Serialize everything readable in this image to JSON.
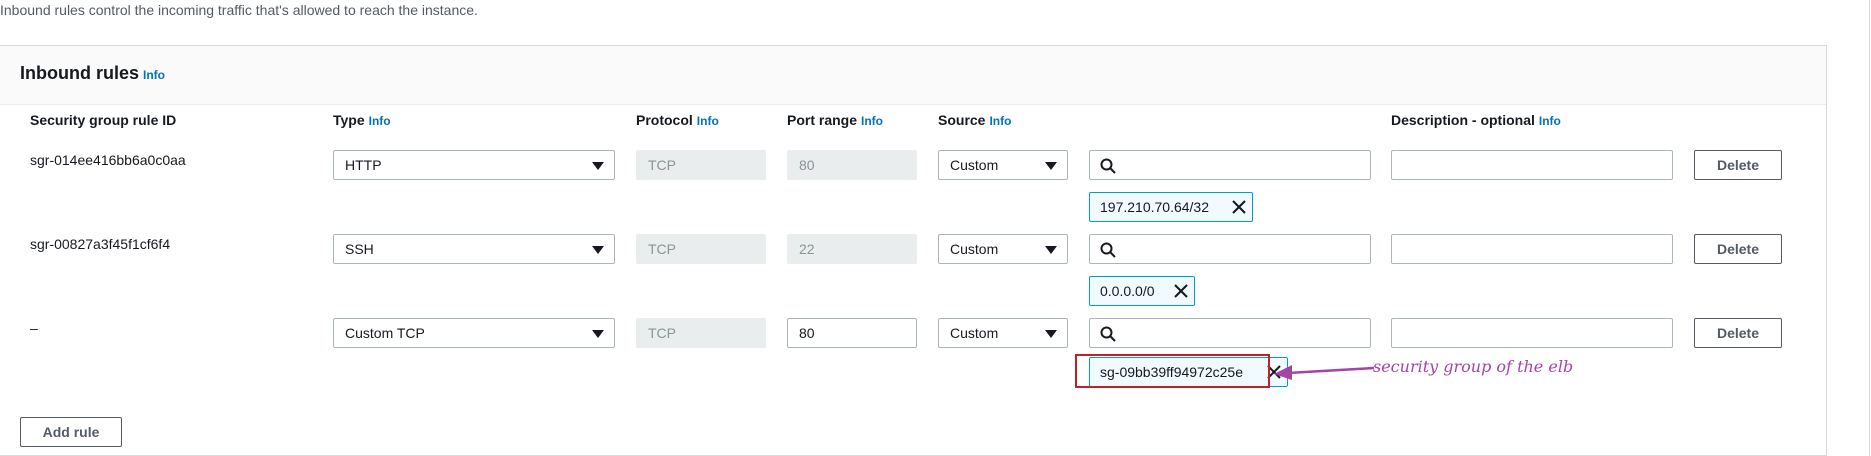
{
  "intro_text": "Inbound rules control the incoming traffic that's allowed to reach the instance.",
  "panel": {
    "title": "Inbound rules",
    "title_info": "Info"
  },
  "columns": {
    "rule_id": "Security group rule ID",
    "type": "Type",
    "type_info": "Info",
    "protocol": "Protocol",
    "protocol_info": "Info",
    "port_range": "Port range",
    "port_info": "Info",
    "source": "Source",
    "source_info": "Info",
    "description": "Description - optional",
    "description_info": "Info"
  },
  "rules": [
    {
      "id": "sgr-014ee416bb6a0c0aa",
      "type": "HTTP",
      "protocol": "TCP",
      "port": "80",
      "source": "Custom",
      "search": "",
      "token": "197.210.70.64/32",
      "description": "",
      "delete": "Delete"
    },
    {
      "id": "sgr-00827a3f45f1cf6f4",
      "type": "SSH",
      "protocol": "TCP",
      "port": "22",
      "source": "Custom",
      "search": "",
      "token": "0.0.0.0/0",
      "description": "",
      "delete": "Delete"
    },
    {
      "id": "–",
      "type": "Custom TCP",
      "protocol": "TCP",
      "port": "80",
      "source": "Custom",
      "search": "",
      "token": "sg-09bb39ff94972c25e",
      "description": "",
      "delete": "Delete"
    }
  ],
  "add_rule": "Add rule",
  "annotation": "security group of the elb",
  "colors": {
    "accent": "#0073bb",
    "token_border": "#00a1c9",
    "highlight": "#c0202a",
    "annotation": "#a344a7"
  },
  "icons": {
    "search": "search-icon",
    "remove": "close-icon",
    "dropdown": "caret-down-icon"
  }
}
